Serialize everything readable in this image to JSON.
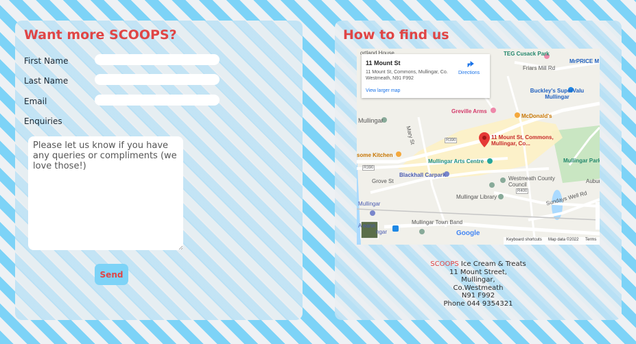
{
  "form": {
    "title": "Want more SCOOPS?",
    "first_name_label": "First Name",
    "last_name_label": "Last Name",
    "email_label": "Email",
    "enquiries_label": "Enquiries",
    "enquiries_placeholder": "Please let us know if you have any queries or compliments (we love those!)",
    "send_label": "Send"
  },
  "location": {
    "title": "How to find us",
    "map": {
      "card_title": "11 Mount St",
      "card_address": "11 Mount St, Commons, Mullingar, Co. Westmeath, N91 F992",
      "directions_label": "Directions",
      "view_larger_label": "View larger map",
      "pin_label": "11 Mount St, Commons, Mullingar, Co...",
      "places": {
        "teg": "TEG Cusack Park",
        "mrprice": "MrPRICE M",
        "friars": "Friars Mill Rd",
        "buckleys": "Buckley's SuperValu Mullingar",
        "greville": "Greville Arms",
        "mcdonalds": "McDonald's",
        "mullingar": "Mullingar",
        "kitchen": "some Kitchen",
        "arts": "Mullingar Arts Centre",
        "blackhall": "Blackhall Carpark",
        "westmeath": "Westmeath County Council",
        "library": "Mullingar Library",
        "park": "Mullingar Park",
        "aubur": "Aubur",
        "sundays": "Sundays Well Rd",
        "town_band": "Mullingar Town Band",
        "mullingar2": "Mullingar",
        "grove": "Grove St",
        "mary": "Mary St",
        "r390a": "R390",
        "r390b": "R390",
        "r400": "R400",
        "ann": "A     eann",
        "ngar": "ngar",
        "top": "ortland House"
      },
      "google": "Google",
      "keyboard": "Keyboard shortcuts",
      "mapdata": "Map data ©2022",
      "terms": "Terms"
    },
    "address": {
      "brand": "SCOOPS",
      "brand_suffix": " Ice Cream & Treats",
      "line1": "11 Mount Street,",
      "line2": "Mullingar,",
      "line3": "Co.Westmeath",
      "line4": "N91 F992",
      "phone": "Phone 044 9354321"
    }
  }
}
